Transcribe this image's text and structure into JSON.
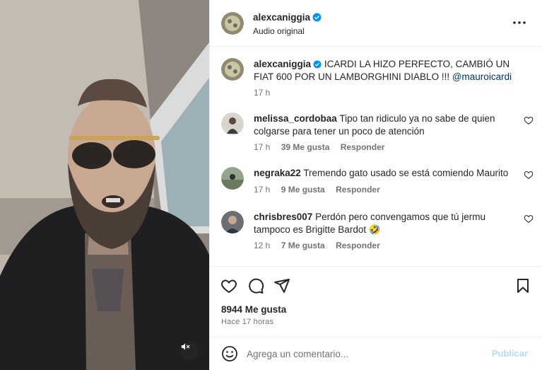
{
  "post": {
    "username": "alexcaniggia",
    "audio_label": "Audio original",
    "icons": {
      "verified": "verified-badge-icon",
      "more": "more-options-icon",
      "mute": "muted-speaker-icon"
    }
  },
  "caption": {
    "username": "alexcaniggia",
    "text": "ICARDI LA HIZO PERFECTO, CAMBIÓ UN FIAT 600 POR UN LAMBORGHINI DIABLO !!!",
    "mention": "@mauroicardi",
    "time": "17 h"
  },
  "comments": [
    {
      "username": "melissa_cordobaa",
      "text": "Tipo tan ridiculo ya no sabe de quien colgarse para tener un poco de atención",
      "time": "17 h",
      "likes": "39 Me gusta",
      "reply": "Responder"
    },
    {
      "username": "negraka22",
      "text": "Tremendo gato usado se está comiendo Maurito",
      "time": "17 h",
      "likes": "9 Me gusta",
      "reply": "Responder"
    },
    {
      "username": "chrisbres007",
      "text": "Perdón pero convengamos que tú jermu tampoco es Brigitte Bardot 🤣",
      "time": "12 h",
      "likes": "7 Me gusta",
      "reply": "Responder"
    }
  ],
  "actions": {
    "icons": [
      "heart-icon",
      "comment-icon",
      "share-icon",
      "bookmark-icon"
    ],
    "likes_total": "8944 Me gusta",
    "time_ago": "Hace 17 horas"
  },
  "add_comment": {
    "placeholder": "Agrega un comentario...",
    "post_label": "Publicar"
  },
  "colors": {
    "link": "#00376b",
    "muted": "#737373",
    "verified": "#0095f6",
    "post_disabled": "#b3dbff"
  }
}
